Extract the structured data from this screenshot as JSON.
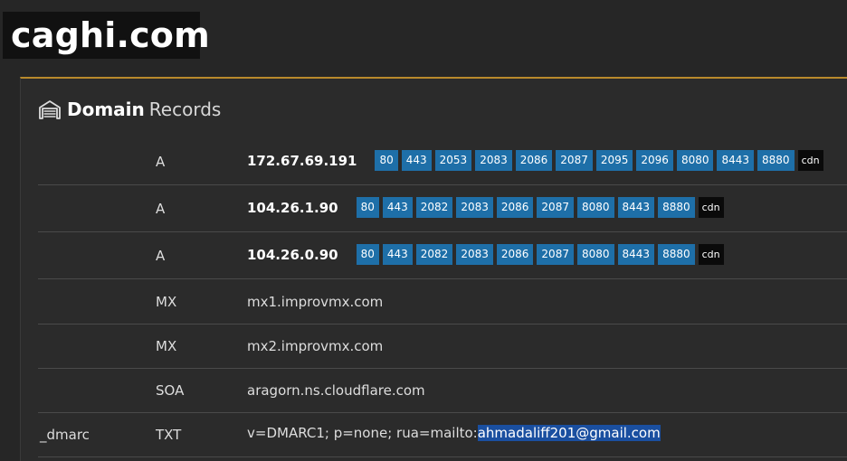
{
  "site": {
    "logo": "caghi.com"
  },
  "panel": {
    "title_bold": "Domain",
    "title_light": "Records",
    "icon": "garage-icon"
  },
  "records": [
    {
      "host": "",
      "type": "A",
      "ip": "172.67.69.191",
      "ports": [
        "80",
        "443",
        "2053",
        "2083",
        "2086",
        "2087",
        "2095",
        "2096",
        "8080",
        "8443",
        "8880"
      ],
      "badge": "cdn"
    },
    {
      "host": "",
      "type": "A",
      "ip": "104.26.1.90",
      "ports": [
        "80",
        "443",
        "2082",
        "2083",
        "2086",
        "2087",
        "8080",
        "8443",
        "8880"
      ],
      "badge": "cdn"
    },
    {
      "host": "",
      "type": "A",
      "ip": "104.26.0.90",
      "ports": [
        "80",
        "443",
        "2082",
        "2083",
        "2086",
        "2087",
        "8080",
        "8443",
        "8880"
      ],
      "badge": "cdn"
    },
    {
      "host": "",
      "type": "MX",
      "value": "mx1.improvmx.com"
    },
    {
      "host": "",
      "type": "MX",
      "value": "mx2.improvmx.com"
    },
    {
      "host": "",
      "type": "SOA",
      "value": "aragorn.ns.cloudflare.com"
    },
    {
      "host": "_dmarc",
      "type": "TXT",
      "value_prefix": "v=DMARC1; p=none; rua=mailto:",
      "value_selected": "ahmadaliff201@gmail.com"
    }
  ],
  "colors": {
    "accent": "#b98a2c",
    "port_badge": "#1e6fa8",
    "cdn_badge": "#0a0a0a",
    "selection": "#1a4fa0"
  }
}
